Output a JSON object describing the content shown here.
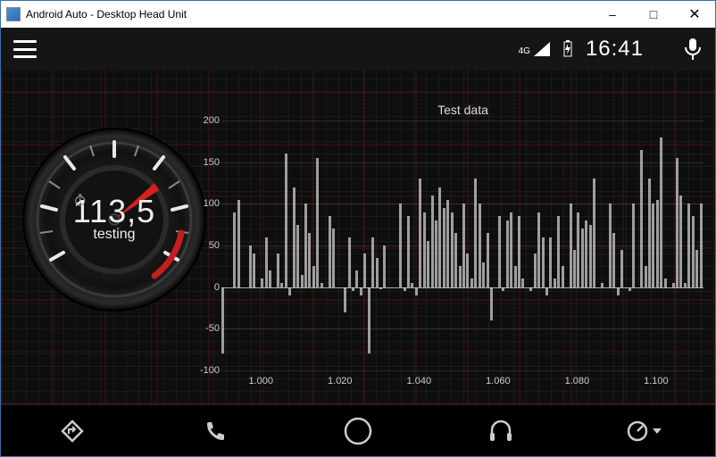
{
  "window": {
    "title": "Android Auto - Desktop Head Unit"
  },
  "status": {
    "network": "4G",
    "battery_charging": true,
    "clock": "16:41"
  },
  "gauge": {
    "value": "113,5",
    "label": "testing"
  },
  "chart_data": {
    "type": "bar",
    "title": "Test data",
    "xlabel": "",
    "ylabel": "",
    "ylim": [
      -100,
      200
    ],
    "yticks": [
      -100,
      -50,
      0,
      50,
      100,
      150,
      200
    ],
    "xticks": [
      "1.000",
      "1.020",
      "1.040",
      "1.060",
      "1.080",
      "1.100"
    ],
    "x_start": 0.99,
    "x_end": 1.112,
    "values": [
      -80,
      0,
      0,
      90,
      105,
      0,
      0,
      50,
      40,
      0,
      10,
      60,
      20,
      0,
      40,
      5,
      160,
      -10,
      120,
      75,
      15,
      100,
      65,
      25,
      155,
      5,
      0,
      85,
      70,
      0,
      0,
      -30,
      60,
      -5,
      20,
      -10,
      40,
      -80,
      60,
      35,
      -2,
      50,
      0,
      0,
      0,
      100,
      -5,
      85,
      5,
      -10,
      130,
      90,
      55,
      110,
      80,
      120,
      95,
      105,
      90,
      65,
      25,
      100,
      40,
      10,
      130,
      100,
      30,
      65,
      -40,
      0,
      85,
      -5,
      80,
      90,
      25,
      85,
      10,
      0,
      -5,
      40,
      90,
      60,
      -10,
      60,
      10,
      85,
      25,
      0,
      100,
      45,
      90,
      70,
      80,
      75,
      130,
      0,
      5,
      0,
      100,
      65,
      -10,
      45,
      0,
      -5,
      100,
      0,
      165,
      25,
      130,
      100,
      105,
      180,
      10,
      0,
      5,
      155,
      110,
      5,
      100,
      85,
      45,
      100
    ]
  },
  "navbar": {
    "items": [
      "navigation",
      "phone",
      "home",
      "media",
      "dashboard"
    ]
  }
}
